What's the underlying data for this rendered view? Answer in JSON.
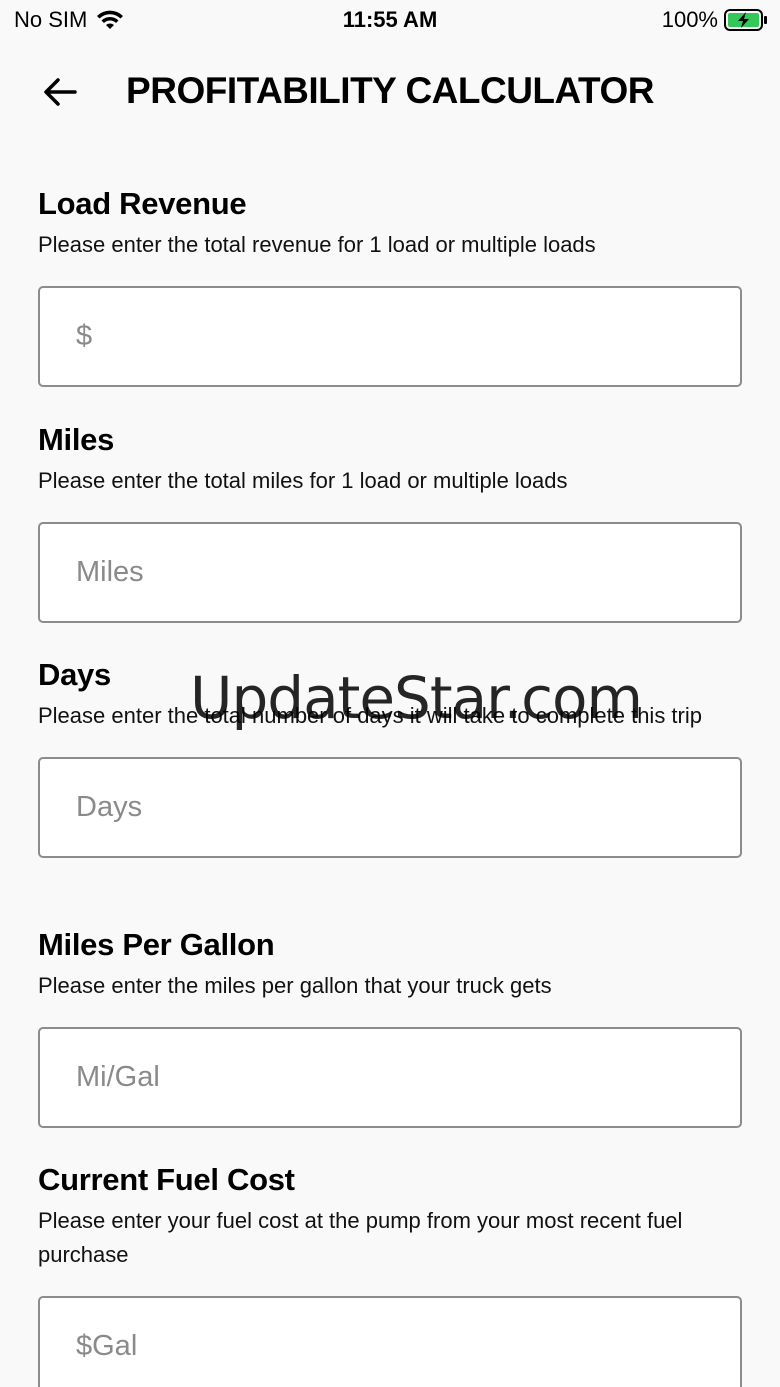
{
  "status_bar": {
    "carrier": "No SIM",
    "time": "11:55 AM",
    "battery_percent": "100%",
    "wifi_icon": "wifi-icon",
    "battery_icon": "battery-charging-icon",
    "battery_color": "#34c759"
  },
  "header": {
    "back_icon": "arrow-left-icon",
    "title": "PROFITABILITY CALCULATOR"
  },
  "form": {
    "fields": [
      {
        "label": "Load Revenue",
        "help": "Please enter the total revenue for 1 load or multiple loads",
        "placeholder": "$",
        "value": ""
      },
      {
        "label": "Miles",
        "help": "Please enter the total miles for 1 load or multiple loads",
        "placeholder": "Miles",
        "value": ""
      },
      {
        "label": "Days",
        "help": "Please enter the total number of days it will take to complete this trip",
        "placeholder": "Days",
        "value": ""
      },
      {
        "label": "Miles Per Gallon",
        "help": "Please enter the miles per gallon that your truck gets",
        "placeholder": "Mi/Gal",
        "value": ""
      },
      {
        "label": "Current Fuel Cost",
        "help": "Please enter your fuel cost at the pump from your most recent fuel purchase",
        "placeholder": "$Gal",
        "value": ""
      }
    ]
  },
  "watermark": "UpdateStar.com"
}
